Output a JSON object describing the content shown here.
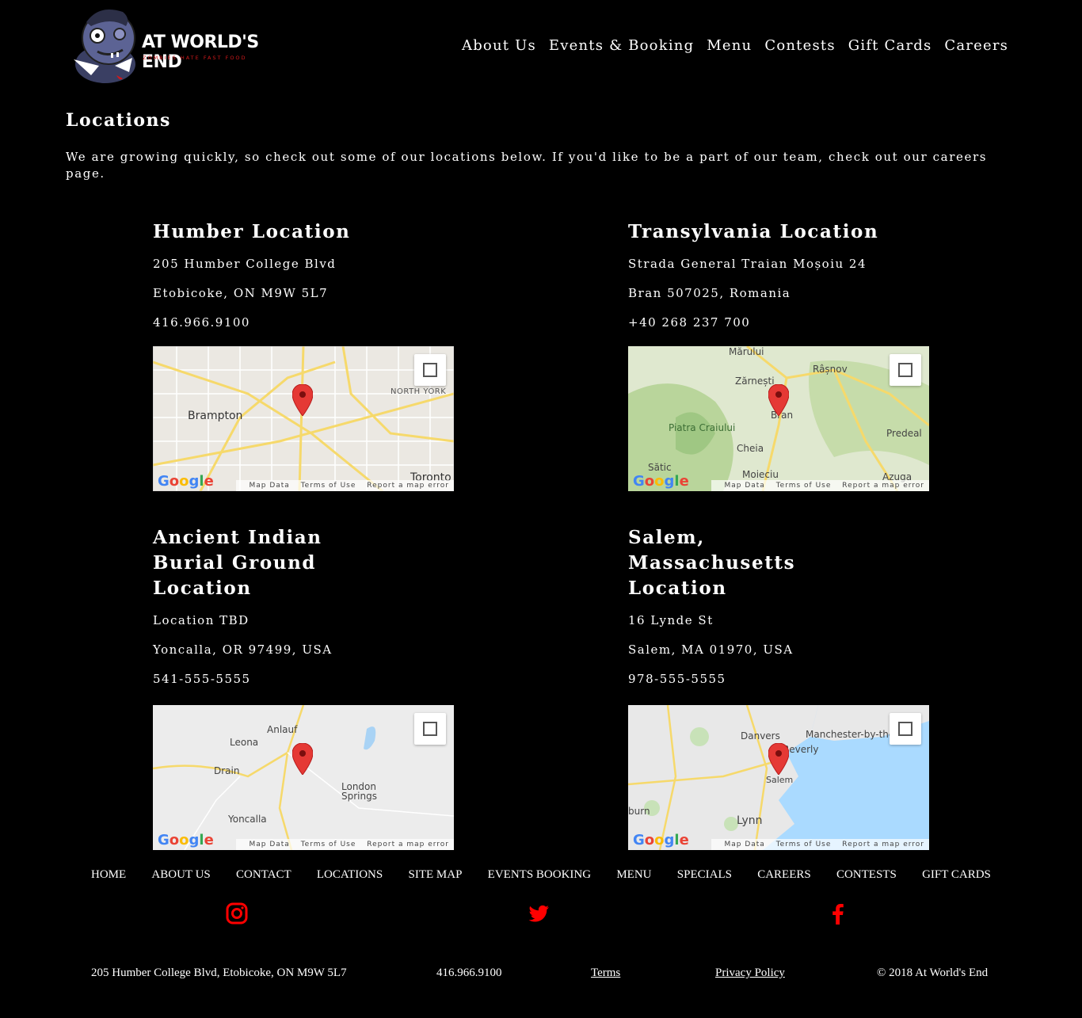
{
  "brand": {
    "name": "AT WORLD'S END",
    "tagline": "ZOMBIES HATE FAST FOOD",
    "accent_color": "#d0191b"
  },
  "nav": {
    "items": [
      "About Us",
      "Events & Booking",
      "Menu",
      "Contests",
      "Gift Cards",
      "Careers"
    ]
  },
  "page": {
    "title": "Locations",
    "intro": "We are growing quickly, so check out some of our locations below. If you'd like to be a part of our team, check out our careers page."
  },
  "locations": [
    {
      "title": "Humber Location",
      "line1": "205 Humber College Blvd",
      "line2": "Etobicoke, ON M9W 5L7",
      "phone": "416.966.9100",
      "map_labels": [
        "Brampton",
        "NORTH YORK",
        "Toronto"
      ]
    },
    {
      "title": "Transylvania Location",
      "line1": "Strada General Traian Moșoiu 24",
      "line2": "Bran 507025, Romania",
      "phone": "+40 268 237 700",
      "map_labels": [
        "Mărului",
        "Râșnov",
        "Zărnești",
        "Bran",
        "Piatra Craiului",
        "Predeal",
        "Cheia",
        "Sătic",
        "Moieciu",
        "Azuga"
      ]
    },
    {
      "title": "Ancient Indian Burial Ground Location",
      "line1": "Location TBD",
      "line2": "Yoncalla, OR 97499, USA",
      "phone": "541-555-5555",
      "map_labels": [
        "Anlauf",
        "Leona",
        "Drain",
        "London Springs",
        "Yoncalla"
      ]
    },
    {
      "title": "Salem, Massachusetts Location",
      "line1": "16 Lynde St",
      "line2": "Salem, MA 01970, USA",
      "phone": "978-555-5555",
      "map_labels": [
        "Danvers",
        "Manchester-by-the-Sea",
        "Beverly",
        "Salem",
        "Lynn",
        "burn"
      ]
    }
  ],
  "map_ui": {
    "google": "Google",
    "map_data": "Map Data",
    "terms": "Terms of Use",
    "report": "Report a map error"
  },
  "footer": {
    "links": [
      "HOME",
      "ABOUT US",
      "CONTACT",
      "LOCATIONS",
      "SITE MAP",
      "EVENTS BOOKING",
      "MENU",
      "SPECIALS",
      "CAREERS",
      "CONTESTS",
      "GIFT CARDS"
    ],
    "social_icons": [
      "instagram-icon",
      "twitter-icon",
      "facebook-icon"
    ],
    "address": "205 Humber College Blvd, Etobicoke, ON M9W 5L7",
    "phone": "416.966.9100",
    "terms": "Terms",
    "privacy": "Privacy Policy",
    "copyright": "© 2018 At World's End"
  }
}
